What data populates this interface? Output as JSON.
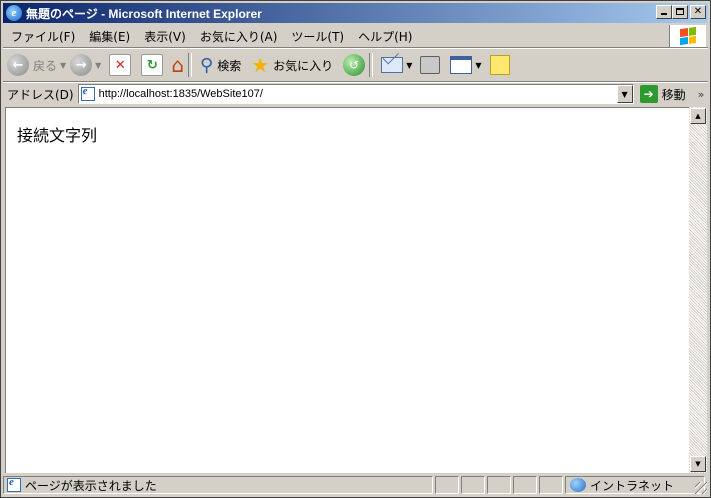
{
  "window": {
    "title": "無題のページ - Microsoft Internet Explorer"
  },
  "menu": {
    "items": [
      "ファイル(F)",
      "編集(E)",
      "表示(V)",
      "お気に入り(A)",
      "ツール(T)",
      "ヘルプ(H)"
    ]
  },
  "toolbar": {
    "back_label": "戻る",
    "search_label": "検索",
    "favorites_label": "お気に入り"
  },
  "address": {
    "label": "アドレス(D)",
    "url": "http://localhost:1835/WebSite107/",
    "go_label": "移動",
    "links_chevron": "»"
  },
  "content": {
    "text": "接続文字列"
  },
  "status": {
    "text": "ページが表示されました",
    "zone": "イントラネット"
  },
  "icons": {
    "app": "ie-logo-icon",
    "back": "back-arrow-icon",
    "forward": "forward-arrow-icon",
    "stop": "stop-icon",
    "refresh": "refresh-icon",
    "home": "home-icon",
    "search": "search-icon",
    "favorites": "star-icon",
    "history": "history-icon",
    "mail": "mail-icon",
    "print": "print-icon",
    "edit": "edit-icon",
    "messenger": "note-icon",
    "go": "go-arrow-icon",
    "zone": "intranet-icon"
  },
  "colors": {
    "titlebar_start": "#0a246a",
    "titlebar_end": "#a6caf0",
    "chrome": "#d4d0c8"
  }
}
